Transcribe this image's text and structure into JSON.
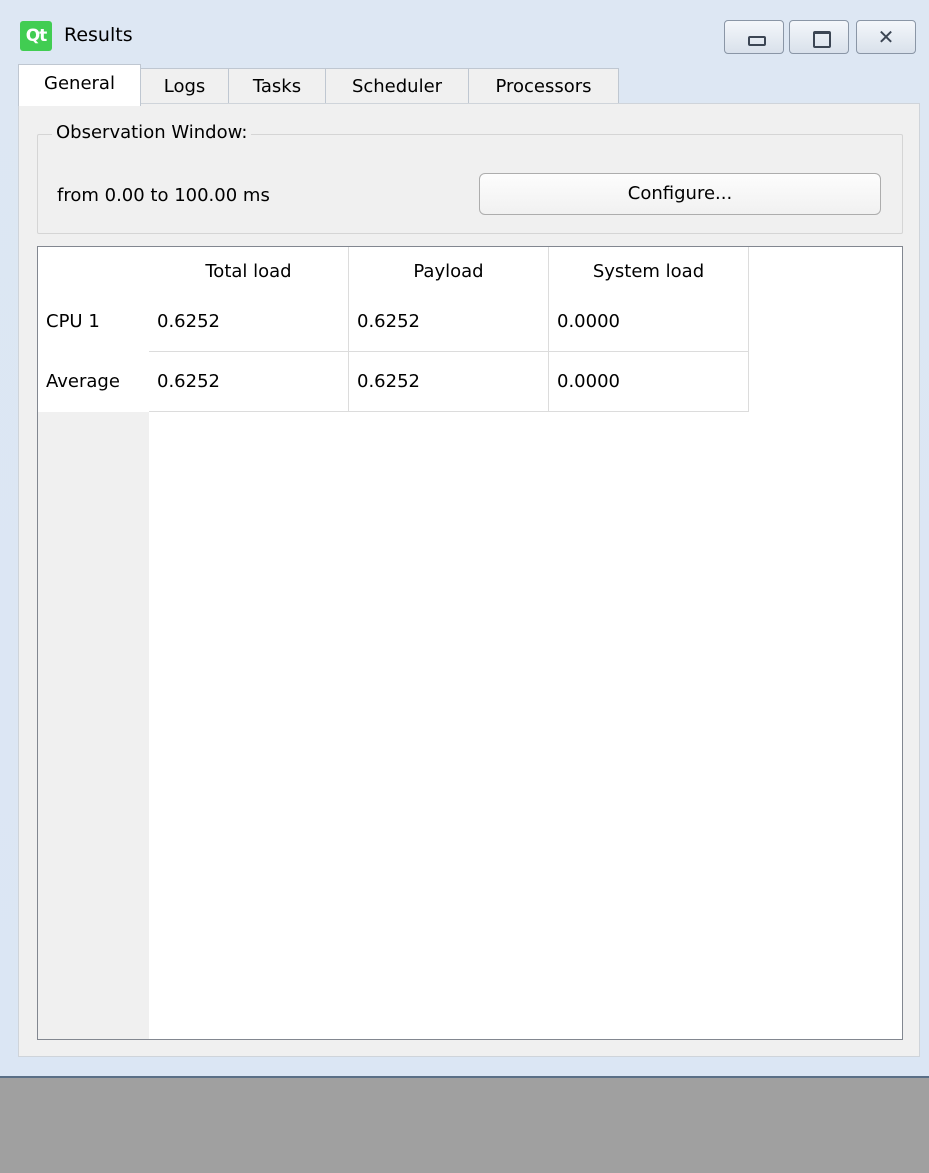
{
  "window": {
    "title": "Results",
    "logo_text": "Qt",
    "controls": {
      "minimize_icon": "minimize-icon",
      "maximize_icon": "maximize-icon",
      "close_icon": "close-icon",
      "close_glyph": "✕"
    }
  },
  "tabs": [
    {
      "label": "General",
      "active": true
    },
    {
      "label": "Logs",
      "active": false
    },
    {
      "label": "Tasks",
      "active": false
    },
    {
      "label": "Scheduler",
      "active": false
    },
    {
      "label": "Processors",
      "active": false
    }
  ],
  "observation": {
    "group_title": "Observation Window:",
    "range_text": "from 0.00 to 100.00 ms",
    "configure_label": "Configure..."
  },
  "results_table": {
    "columns": [
      "Total load",
      "Payload",
      "System load"
    ],
    "rows": [
      {
        "label": "CPU 1",
        "values": [
          "0.6252",
          "0.6252",
          "0.0000"
        ]
      },
      {
        "label": "Average",
        "values": [
          "0.6252",
          "0.6252",
          "0.0000"
        ]
      }
    ]
  },
  "colors": {
    "qt_green": "#41cd52",
    "titlebar_bg": "#dbe6f4",
    "desktop_bg": "#a0a0a0"
  }
}
